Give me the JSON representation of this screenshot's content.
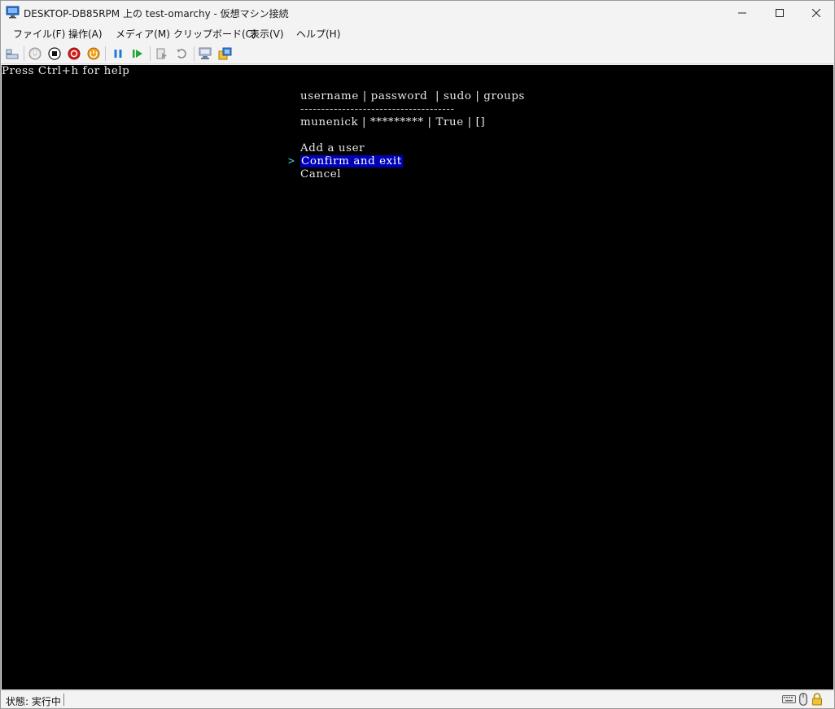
{
  "window": {
    "title": "DESKTOP-DB85RPM 上の test-omarchy - 仮想マシン接続",
    "minimize_glyph": "—",
    "maximize_glyph": "☐",
    "close_glyph": "✕"
  },
  "menu": {
    "items": [
      "ファイル(F)",
      "操作(A)",
      "メディア(M)",
      "クリップボード(C)",
      "表示(V)",
      "ヘルプ(H)"
    ]
  },
  "toolbar": {
    "buttons": [
      "ctrl-alt-del",
      "start",
      "turn-off",
      "shut-down",
      "save",
      "pause",
      "resume",
      "checkpoint",
      "revert",
      "enhanced-session",
      "share"
    ]
  },
  "console": {
    "help_line": "Press Ctrl+h for help",
    "table_header": "username | password  | sudo | groups",
    "table_separator": "-------------------------------------",
    "table_row": "munenick | ********* | True | []",
    "menu_add": "Add a user",
    "menu_confirm": "Confirm and exit",
    "menu_cancel": "Cancel",
    "cursor": ">",
    "highlight_color": "#0000b8",
    "cursor_color": "#3fd2d2"
  },
  "status": {
    "text": "状態: 実行中"
  }
}
